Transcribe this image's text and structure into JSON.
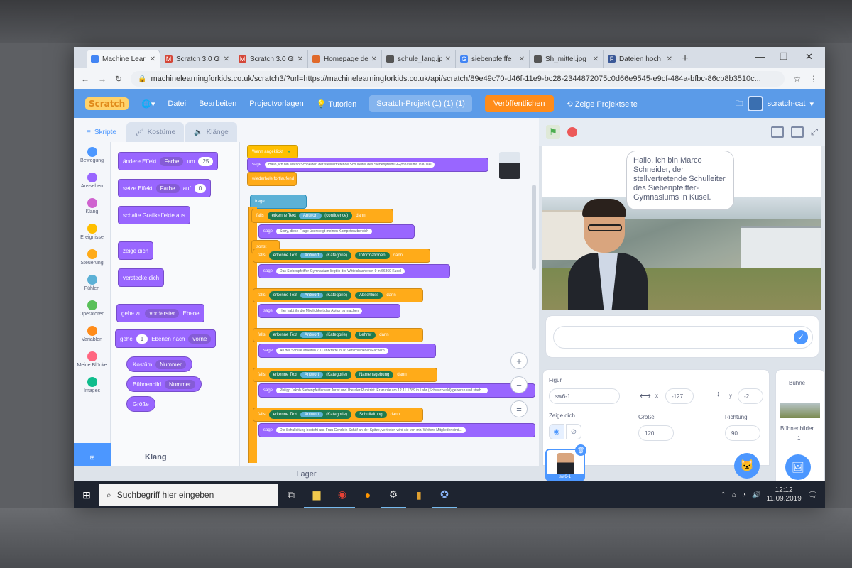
{
  "browser": {
    "tabs": [
      {
        "label": "Machine Lear",
        "icon": "globe-icon",
        "color": "#4285f4"
      },
      {
        "label": "Scratch 3.0 GL",
        "icon": "gmail-icon",
        "color": "#d44638"
      },
      {
        "label": "Scratch 3.0 GL",
        "icon": "gmail-icon",
        "color": "#d44638"
      },
      {
        "label": "Homepage de",
        "icon": "site-icon",
        "color": "#e06a2b"
      },
      {
        "label": "schule_lang.jp",
        "icon": "globe-icon",
        "color": "#555555"
      },
      {
        "label": "siebenpfeiffe",
        "icon": "google-icon",
        "color": "#4285f4"
      },
      {
        "label": "Sh_mittel.jpg",
        "icon": "globe-icon",
        "color": "#555555"
      },
      {
        "label": "Dateien hoch",
        "icon": "f-icon",
        "color": "#3b5998"
      }
    ],
    "new_tab": "+",
    "url": "machinelearningforkids.co.uk/scratch3/?url=https://machinelearningforkids.co.uk/api/scratch/89e49c70-d46f-11e9-bc28-2344872075c0d66e9545-e9cf-484a-bfbc-86cb8b3510c..."
  },
  "scratch": {
    "logo": "Scratch",
    "menu": [
      "Datei",
      "Bearbeiten",
      "Projectvorlagen",
      "Tutorien"
    ],
    "project_title": "Scratch-Projekt (1) (1) (1)",
    "share_button": "Veröffentlichen",
    "see_project_page": "Zeige Projektseite",
    "username": "scratch-cat",
    "editor_tabs": [
      "Skripte",
      "Kostüme",
      "Klänge"
    ],
    "categories": [
      {
        "label": "Bewegung",
        "color": "#4c97ff"
      },
      {
        "label": "Aussehen",
        "color": "#9966ff"
      },
      {
        "label": "Klang",
        "color": "#cf63cf"
      },
      {
        "label": "Ereignisse",
        "color": "#ffbf00"
      },
      {
        "label": "Steuerung",
        "color": "#ffab19"
      },
      {
        "label": "Fühlen",
        "color": "#5cb1d6"
      },
      {
        "label": "Operatoren",
        "color": "#59c059"
      },
      {
        "label": "Variablen",
        "color": "#ff8c1a"
      },
      {
        "label": "Meine Blöcke",
        "color": "#ff6680"
      },
      {
        "label": "Images",
        "color": "#0fbd8c"
      }
    ],
    "palette": {
      "change_effect": {
        "text": "ändere Effekt",
        "dropdown": "Farbe",
        "mid": "um",
        "value": "25"
      },
      "set_effect": {
        "text": "setze Effekt",
        "dropdown": "Farbe",
        "mid": "auf",
        "value": "0"
      },
      "clear_effects": "schalte Grafikeffekte aus",
      "show": "zeige dich",
      "hide": "verstecke dich",
      "go_to_layer": {
        "text": "gehe zu",
        "dropdown": "vorderster",
        "end": "Ebene"
      },
      "go_layers": {
        "text": "gehe",
        "value": "1",
        "mid": "Ebenen nach",
        "dropdown": "vorne"
      },
      "costume_reporter": {
        "text": "Kostüm",
        "dropdown": "Nummer"
      },
      "backdrop_reporter": {
        "text": "Bühnenbild",
        "dropdown": "Nummer"
      },
      "size_reporter": "Größe",
      "section_klang": "Klang"
    },
    "script": {
      "hat": "Wenn angeklickt",
      "say1": {
        "text": "sage",
        "in": "Hallo, ich bin Marco Schneider, der stellvertretende Schulleiter des Siebenpfeiffer-Gymnasiums in Kusel"
      },
      "ask_wait": "wiederhole fortlaufend",
      "ask": "frage",
      "if_label": "falls",
      "then_label": "dann",
      "else_label": "sonst",
      "recognise": "erkenne Text",
      "answer": "Antwort",
      "confidence": "(confidence)",
      "label": "(Kategorie)",
      "say_sorry": "Sorry, diese Frage übersteigt meinen Kompetenzbereich",
      "rows": [
        {
          "category": "Informationen",
          "say": "Das Siebenpfeiffer-Gymnasium liegt in der Wittelsbacherstr. 9 in 66869 Kusel"
        },
        {
          "category": "Abschluss",
          "say": "Hier habt ihr die Möglichkeit das Abitur zu machen"
        },
        {
          "category": "Lehrer",
          "say": "An der Schule arbeiten 70 Lehrkräfte in 16 verschiedenen Fächern"
        },
        {
          "category": "Namensgebung",
          "say": "Philipp Jakob Siebenpfeiffer war Jurist und liberaler Publizist. Er wurde am 12.11.1789 in Lahr (Schwarzwald) geboren und starb..."
        },
        {
          "category": "Schulleitung",
          "say": "Die Schulleitung besteht aus Frau Gehrlein-Schäf an der Spitze, vertreten wird sie von mir. Weitere Mitglieder sind..."
        }
      ]
    },
    "stage": {
      "speech": "Hallo, ich bin Marco Schneider, der stellvertretende Schulleiter des Siebenpfeiffer-Gymnasiums in Kusel."
    },
    "sprite_info": {
      "sprite_label": "Figur",
      "sprite_name": "sw6-1",
      "x_label": "x",
      "x_value": "-127",
      "y_label": "y",
      "y_value": "-2",
      "show_label": "Zeige dich",
      "size_label": "Größe",
      "size_value": "120",
      "direction_label": "Richtung",
      "direction_value": "90",
      "tile_name": "sw6-1"
    },
    "stage_panel": {
      "title": "Bühne",
      "backdrops_label": "Bühnenbilder",
      "backdrops_count": "1"
    },
    "backpack": "Lager"
  },
  "taskbar": {
    "search_placeholder": "Suchbegriff hier eingeben",
    "time": "12:12",
    "date": "11.09.2019"
  }
}
